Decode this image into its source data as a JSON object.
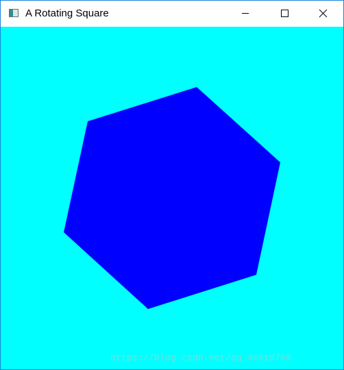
{
  "window": {
    "title": "A Rotating Square"
  },
  "titlebar_icons": {
    "app": "app-icon",
    "minimize": "minimize-icon",
    "maximize": "maximize-icon",
    "close": "close-icon"
  },
  "colors": {
    "background": "#00ffff",
    "shape": "#0000ff"
  },
  "watermark": {
    "text": "https://blog.csdn.net/qq_40610760"
  }
}
